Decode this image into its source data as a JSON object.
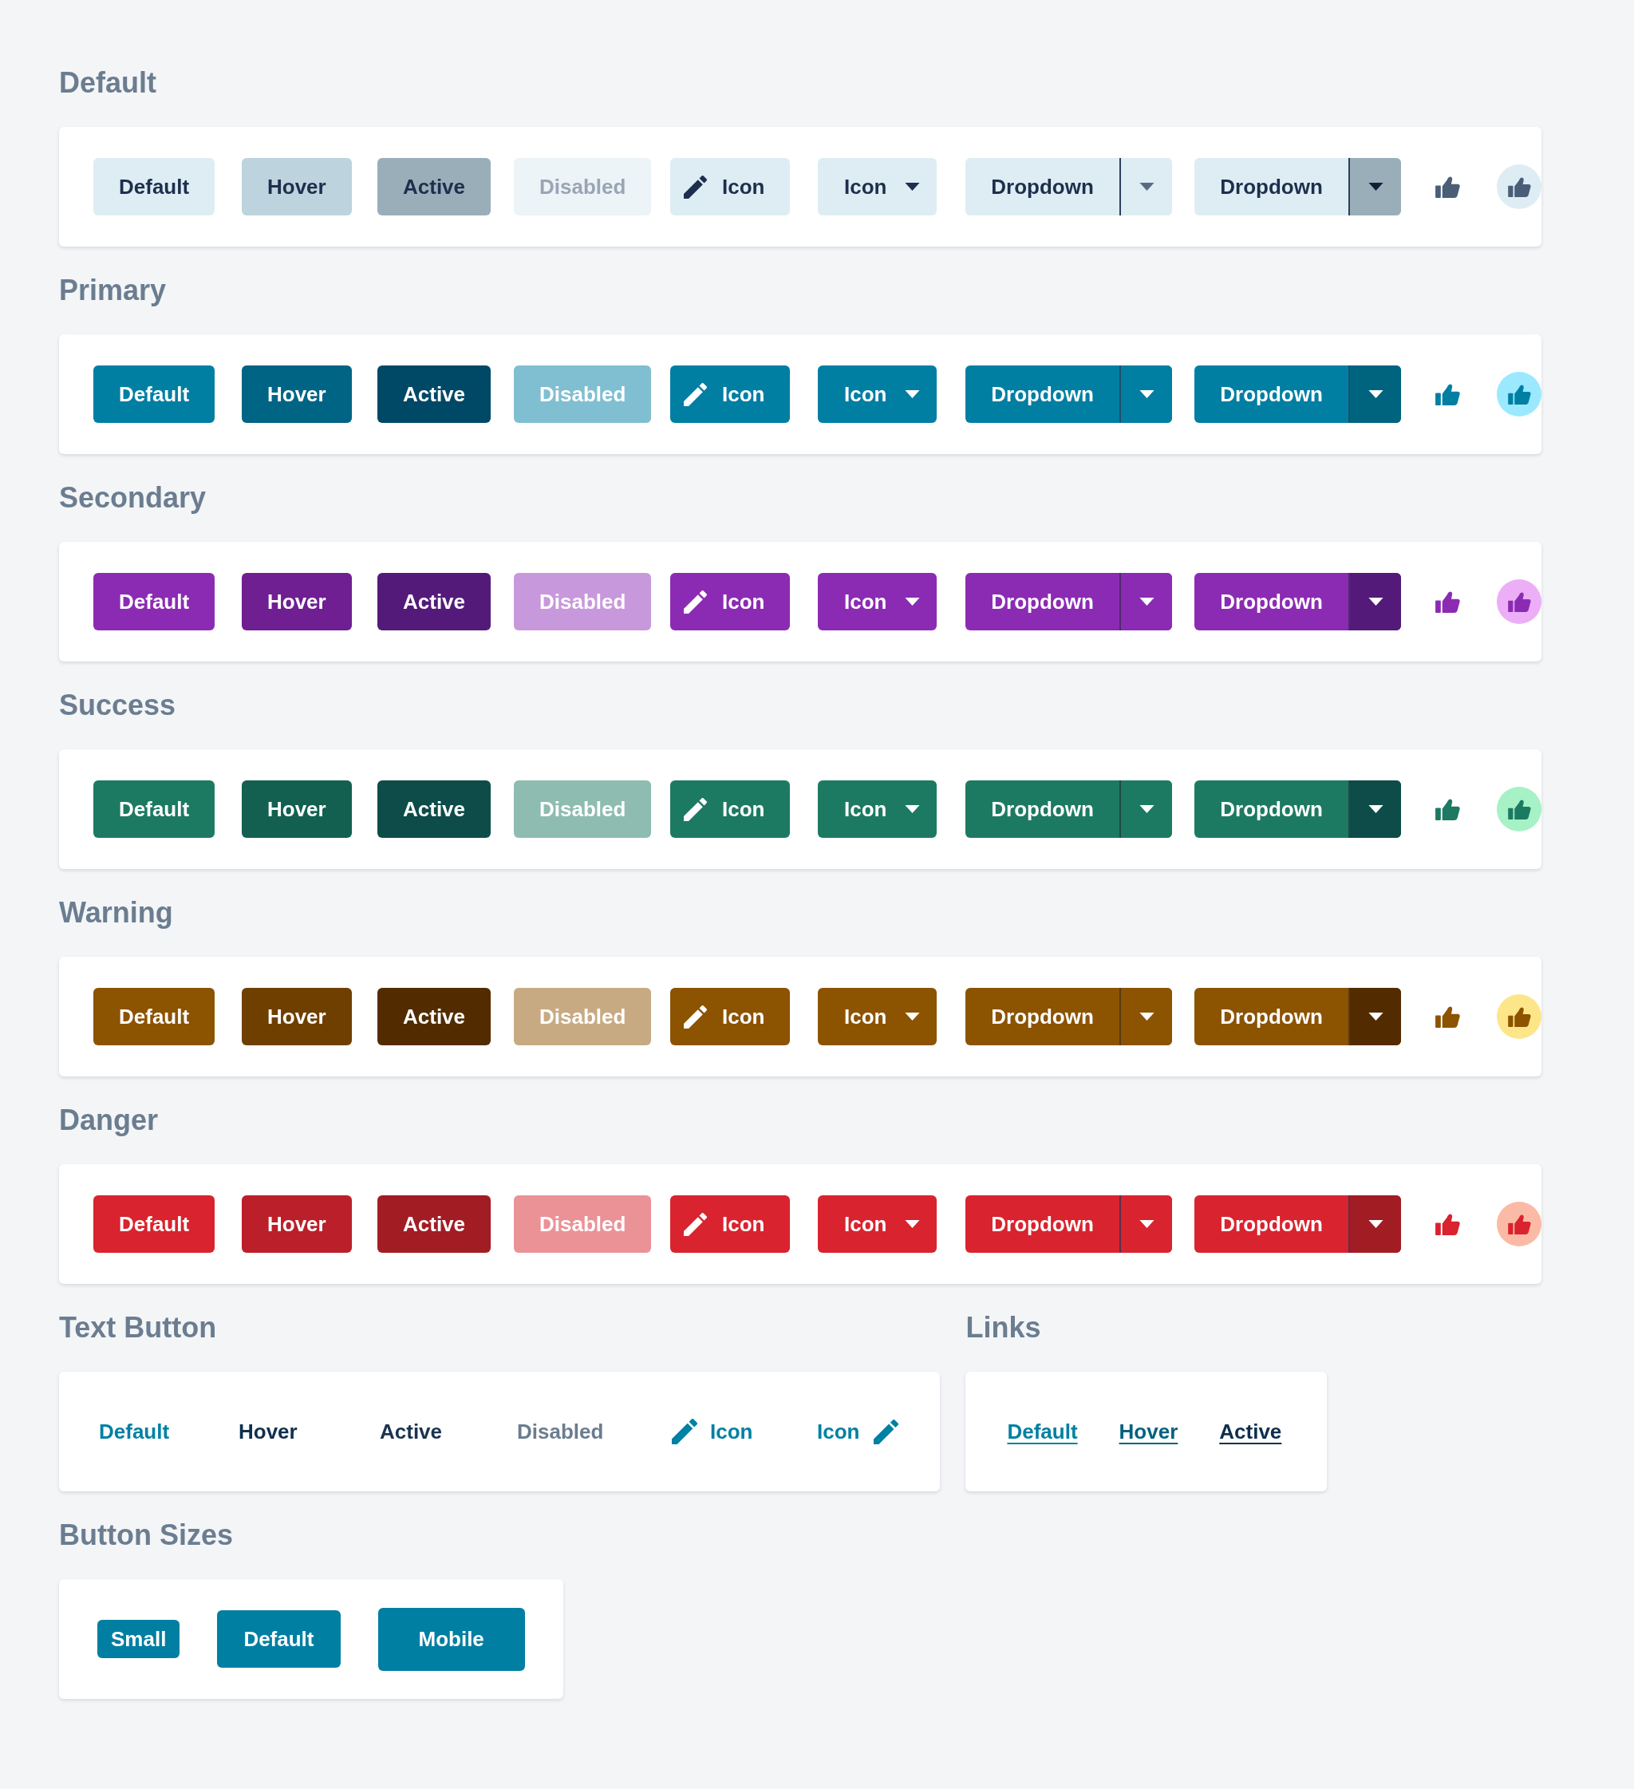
{
  "rows": [
    [
      {
        "title": "Default",
        "kind": "states",
        "items": [
          {
            "kind": "button",
            "label": "Default",
            "hover": false,
            "active": false,
            "disabled": false
          },
          {
            "kind": "button",
            "label": "Hover",
            "hover": true,
            "active": false,
            "disabled": false
          },
          {
            "kind": "button",
            "label": "Active",
            "hover": false,
            "active": true,
            "disabled": false
          },
          {
            "kind": "button",
            "label": "Disabled",
            "hover": false,
            "active": false,
            "disabled": true
          },
          {
            "kind": "icon-left",
            "label": "Icon",
            "hover": false,
            "active": false,
            "disabled": false
          },
          {
            "kind": "caret",
            "label": "Icon",
            "hover": false,
            "active": false,
            "disabled": false
          },
          {
            "kind": "split",
            "label": "Dropdown",
            "hover": false,
            "active": false,
            "disabled": false
          },
          {
            "kind": "split",
            "label": "Dropdown",
            "hover": false,
            "active": true,
            "disabled": false
          },
          {
            "kind": "icon-only",
            "hover": false,
            "active": false,
            "disabled": false
          },
          {
            "kind": "icon-only",
            "hover": false,
            "active": true,
            "disabled": false
          }
        ]
      }
    ],
    [
      {
        "title": "Primary",
        "kind": "states",
        "items": [
          {
            "kind": "button",
            "label": "Default",
            "hover": false,
            "active": false,
            "disabled": false
          },
          {
            "kind": "button",
            "label": "Hover",
            "hover": true,
            "active": false,
            "disabled": false
          },
          {
            "kind": "button",
            "label": "Active",
            "hover": false,
            "active": true,
            "disabled": false
          },
          {
            "kind": "button",
            "label": "Disabled",
            "hover": false,
            "active": false,
            "disabled": true
          },
          {
            "kind": "icon-left",
            "label": "Icon",
            "hover": false,
            "active": false,
            "disabled": false
          },
          {
            "kind": "caret",
            "label": "Icon",
            "hover": false,
            "active": false,
            "disabled": false
          },
          {
            "kind": "split",
            "label": "Dropdown",
            "hover": false,
            "active": false,
            "disabled": false
          },
          {
            "kind": "split",
            "label": "Dropdown",
            "hover": false,
            "active": true,
            "disabled": false
          },
          {
            "kind": "icon-only",
            "hover": false,
            "active": false,
            "disabled": false
          },
          {
            "kind": "icon-only",
            "hover": false,
            "active": true,
            "disabled": false
          }
        ]
      }
    ],
    [
      {
        "title": "Secondary",
        "kind": "states",
        "items": [
          {
            "kind": "button",
            "label": "Default",
            "hover": false,
            "active": false,
            "disabled": false
          },
          {
            "kind": "button",
            "label": "Hover",
            "hover": true,
            "active": false,
            "disabled": false
          },
          {
            "kind": "button",
            "label": "Active",
            "hover": false,
            "active": true,
            "disabled": false
          },
          {
            "kind": "button",
            "label": "Disabled",
            "hover": false,
            "active": false,
            "disabled": true
          },
          {
            "kind": "icon-left",
            "label": "Icon",
            "hover": false,
            "active": false,
            "disabled": false
          },
          {
            "kind": "caret",
            "label": "Icon",
            "hover": false,
            "active": false,
            "disabled": false
          },
          {
            "kind": "split",
            "label": "Dropdown",
            "hover": false,
            "active": false,
            "disabled": false
          },
          {
            "kind": "split",
            "label": "Dropdown",
            "hover": false,
            "active": true,
            "disabled": false
          },
          {
            "kind": "icon-only",
            "hover": false,
            "active": false,
            "disabled": false
          },
          {
            "kind": "icon-only",
            "hover": false,
            "active": true,
            "disabled": false
          }
        ]
      }
    ],
    [
      {
        "title": "Success",
        "kind": "states",
        "items": [
          {
            "kind": "button",
            "label": "Default",
            "hover": false,
            "active": false,
            "disabled": false
          },
          {
            "kind": "button",
            "label": "Hover",
            "hover": true,
            "active": false,
            "disabled": false
          },
          {
            "kind": "button",
            "label": "Active",
            "hover": false,
            "active": true,
            "disabled": false
          },
          {
            "kind": "button",
            "label": "Disabled",
            "hover": false,
            "active": false,
            "disabled": true
          },
          {
            "kind": "icon-left",
            "label": "Icon",
            "hover": false,
            "active": false,
            "disabled": false
          },
          {
            "kind": "caret",
            "label": "Icon",
            "hover": false,
            "active": false,
            "disabled": false
          },
          {
            "kind": "split",
            "label": "Dropdown",
            "hover": false,
            "active": false,
            "disabled": false
          },
          {
            "kind": "split",
            "label": "Dropdown",
            "hover": false,
            "active": true,
            "disabled": false
          },
          {
            "kind": "icon-only",
            "hover": false,
            "active": false,
            "disabled": false
          },
          {
            "kind": "icon-only",
            "hover": false,
            "active": true,
            "disabled": false
          }
        ]
      }
    ],
    [
      {
        "title": "Warning",
        "kind": "states",
        "items": [
          {
            "kind": "button",
            "label": "Default",
            "hover": false,
            "active": false,
            "disabled": false
          },
          {
            "kind": "button",
            "label": "Hover",
            "hover": true,
            "active": false,
            "disabled": false
          },
          {
            "kind": "button",
            "label": "Active",
            "hover": false,
            "active": true,
            "disabled": false
          },
          {
            "kind": "button",
            "label": "Disabled",
            "hover": false,
            "active": false,
            "disabled": true
          },
          {
            "kind": "icon-left",
            "label": "Icon",
            "hover": false,
            "active": false,
            "disabled": false
          },
          {
            "kind": "caret",
            "label": "Icon",
            "hover": false,
            "active": false,
            "disabled": false
          },
          {
            "kind": "split",
            "label": "Dropdown",
            "hover": false,
            "active": false,
            "disabled": false
          },
          {
            "kind": "split",
            "label": "Dropdown",
            "hover": false,
            "active": true,
            "disabled": false
          },
          {
            "kind": "icon-only",
            "hover": false,
            "active": false,
            "disabled": false
          },
          {
            "kind": "icon-only",
            "hover": false,
            "active": true,
            "disabled": false
          }
        ]
      }
    ],
    [
      {
        "title": "Danger",
        "kind": "states",
        "items": [
          {
            "kind": "button",
            "label": "Default",
            "hover": false,
            "active": false,
            "disabled": false
          },
          {
            "kind": "button",
            "label": "Hover",
            "hover": true,
            "active": false,
            "disabled": false
          },
          {
            "kind": "button",
            "label": "Active",
            "hover": false,
            "active": true,
            "disabled": false
          },
          {
            "kind": "button",
            "label": "Disabled",
            "hover": false,
            "active": false,
            "disabled": true
          },
          {
            "kind": "icon-left",
            "label": "Icon",
            "hover": false,
            "active": false,
            "disabled": false
          },
          {
            "kind": "caret",
            "label": "Icon",
            "hover": false,
            "active": false,
            "disabled": false
          },
          {
            "kind": "split",
            "label": "Dropdown",
            "hover": false,
            "active": false,
            "disabled": false
          },
          {
            "kind": "split",
            "label": "Dropdown",
            "hover": false,
            "active": true,
            "disabled": false
          },
          {
            "kind": "icon-only",
            "hover": false,
            "active": false,
            "disabled": false
          },
          {
            "kind": "icon-only",
            "hover": false,
            "active": true,
            "disabled": false
          }
        ]
      }
    ],
    [
      {
        "title": "Text Button",
        "kind": "text",
        "items": [
          {
            "kind": "button",
            "label": "Default",
            "hover": false,
            "active": false,
            "disabled": false
          },
          {
            "kind": "button",
            "label": "Hover",
            "hover": true,
            "active": false,
            "disabled": false
          },
          {
            "kind": "button",
            "label": "Active",
            "hover": false,
            "active": true,
            "disabled": false
          },
          {
            "kind": "button",
            "label": "Disabled",
            "hover": false,
            "active": false,
            "disabled": true
          },
          {
            "kind": "icon-left",
            "label": "Icon",
            "hover": false,
            "active": false,
            "disabled": false
          },
          {
            "kind": "icon-right",
            "label": "Icon",
            "hover": false,
            "active": false,
            "disabled": false
          }
        ]
      },
      {
        "title": "Links",
        "kind": "links",
        "items": [
          {
            "kind": "link",
            "label": "Default",
            "hover": false,
            "active": false
          },
          {
            "kind": "link",
            "label": "Hover",
            "hover": true,
            "active": false
          },
          {
            "kind": "link",
            "label": "Active",
            "hover": false,
            "active": true
          }
        ]
      }
    ],
    [
      {
        "title": "Button Sizes",
        "kind": "sizes",
        "items": [
          {
            "kind": "small",
            "label": "Small",
            "hover": false,
            "active": false,
            "disabled": false
          },
          {
            "kind": "regular",
            "label": "Default",
            "hover": false,
            "active": false,
            "disabled": false
          },
          {
            "kind": "mobile",
            "label": "Mobile",
            "hover": false,
            "active": false,
            "disabled": false
          }
        ]
      }
    ]
  ]
}
